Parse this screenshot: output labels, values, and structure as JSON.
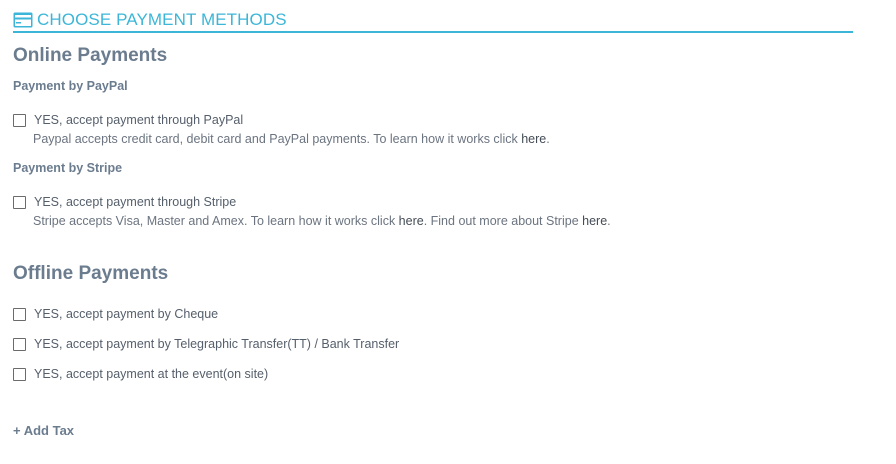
{
  "header": {
    "title": "CHOOSE PAYMENT METHODS",
    "icon": "credit-card-icon",
    "accent_color": "#3cb6d8"
  },
  "online": {
    "title": "Online Payments",
    "paypal": {
      "subtitle": "Payment by PayPal",
      "checkbox_label": "YES, accept payment through PayPal",
      "checked": false,
      "desc_text": "Paypal accepts credit card, debit card and PayPal payments. To learn how it works click ",
      "link_label": "here",
      "desc_end": "."
    },
    "stripe": {
      "subtitle": "Payment by Stripe",
      "checkbox_label": "YES, accept payment through Stripe",
      "checked": false,
      "desc_text": "Stripe accepts Visa, Master and Amex. To learn how it works click ",
      "link1_label": "here",
      "desc_middle": ". Find out more about Stripe ",
      "link2_label": "here",
      "desc_end": "."
    }
  },
  "offline": {
    "title": "Offline Payments",
    "options": [
      {
        "label": "YES, accept payment by Cheque",
        "checked": false
      },
      {
        "label": "YES, accept payment by Telegraphic Transfer(TT) / Bank Transfer",
        "checked": false
      },
      {
        "label": "YES, accept payment at the event(on site)",
        "checked": false
      }
    ]
  },
  "add_tax_label": "+ Add Tax"
}
